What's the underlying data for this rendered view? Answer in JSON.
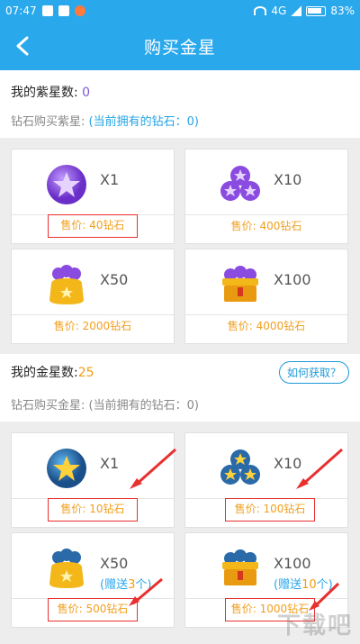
{
  "status": {
    "time": "07:47",
    "network": "4G",
    "battery": "83%"
  },
  "header": {
    "title": "购买金星"
  },
  "purple": {
    "heading_prefix": "我的紫星数: ",
    "count": "0",
    "sub_prefix": "钻石购买紫星: ",
    "sub_value": "(当前拥有的钻石：0)",
    "items": [
      {
        "qty": "X1",
        "price": "售价: 40钻石",
        "boxed": true
      },
      {
        "qty": "X10",
        "price": "售价: 400钻石",
        "boxed": false
      },
      {
        "qty": "X50",
        "price": "售价: 2000钻石",
        "boxed": false
      },
      {
        "qty": "X100",
        "price": "售价: 4000钻石",
        "boxed": false
      }
    ]
  },
  "gold": {
    "heading_prefix": "我的金星数:",
    "count": "25",
    "how_button": "如何获取？",
    "sub_prefix": "钻石购买金星: ",
    "sub_value": "(当前拥有的钻石：0)",
    "items": [
      {
        "qty": "X1",
        "price": "售价: 10钻石",
        "bonus": ""
      },
      {
        "qty": "X10",
        "price": "售价: 100钻石",
        "bonus": ""
      },
      {
        "qty": "X50",
        "price": "售价: 500钻石",
        "bonus_prefix": "(赠送",
        "bonus_num": "3",
        "bonus_suffix": "个)"
      },
      {
        "qty": "X100",
        "price": "售价: 1000钻石",
        "bonus_prefix": "(赠送",
        "bonus_num": "10",
        "bonus_suffix": "个)"
      }
    ]
  },
  "colors": {
    "header": "#2aa8ec",
    "purple_count": "#7f56d9",
    "gold_count": "#f39c12",
    "price": "#f0a020",
    "highlight_box": "#e8302f"
  },
  "watermark": "下载吧"
}
